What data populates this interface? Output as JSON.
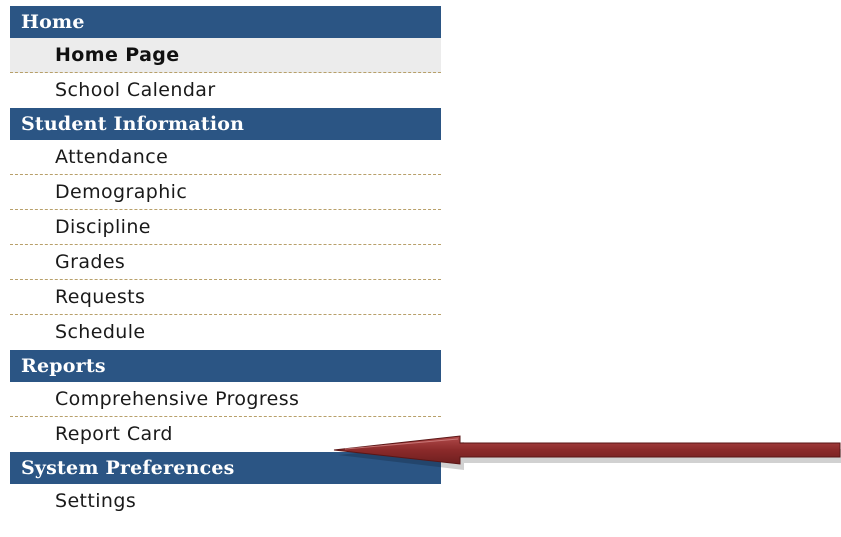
{
  "nav": {
    "sections": [
      {
        "title": "Home",
        "items": [
          "Home Page",
          "School Calendar"
        ]
      },
      {
        "title": "Student Information",
        "items": [
          "Attendance",
          "Demographic",
          "Discipline",
          "Grades",
          "Requests",
          "Schedule"
        ]
      },
      {
        "title": "Reports",
        "items": [
          "Comprehensive Progress",
          "Report Card"
        ]
      },
      {
        "title": "System Preferences",
        "items": [
          "Settings"
        ]
      }
    ],
    "selected_item": "Home Page"
  },
  "colors": {
    "header_bg": "#2b5584",
    "header_text": "#ffffff",
    "selected_bg": "#ececec",
    "divider": "#b8a06a",
    "arrow": "#8b2a2a"
  },
  "annotation": {
    "arrow_icon": "red-arrow-icon",
    "points_to": "Report Card"
  }
}
